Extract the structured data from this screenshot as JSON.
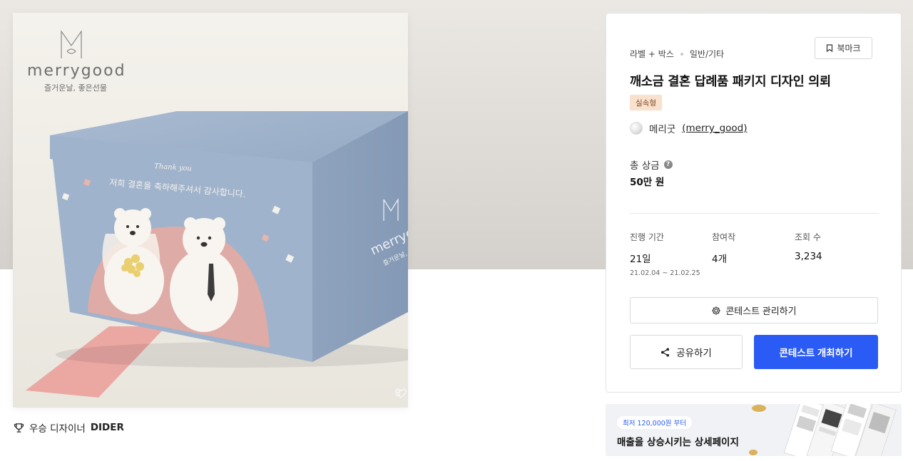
{
  "product": {
    "brand_name": "merrygood",
    "brand_tagline": "즐거운날, 좋은선물",
    "box_script": "Thank you",
    "box_message": "저희 결혼을 축하해주셔서 감사합니다.",
    "side_brand": "merrygood",
    "side_tagline": "즐거운날, 좋은선물",
    "like_count": "3"
  },
  "winner": {
    "prefix": "우승 디자이너",
    "name": "DIDER"
  },
  "contest": {
    "category": "라벨 + 박스",
    "subcategory": "일반/기타",
    "bookmark_label": "북마크",
    "title": "깨소금 결혼 답례품 패키지 디자인 의뢰",
    "badge": "실속형",
    "author_name": "메리굿",
    "author_handle": "(merry_good)",
    "prize_label": "총 상금",
    "prize_value": "50만 원",
    "stats": {
      "period_label": "진행 기간",
      "period_value": "21일",
      "period_range": "21.02.04 ~ 21.02.25",
      "entries_label": "참여작",
      "entries_value": "4개",
      "views_label": "조회 수",
      "views_value": "3,234"
    },
    "manage_label": "콘테스트 관리하기",
    "share_label": "공유하기",
    "host_label": "콘테스트 개최하기"
  },
  "banner": {
    "pill": "최저 120,000원 부터",
    "headline": "매출을 상승시키는 상세페이지"
  },
  "colors": {
    "primary": "#2a5bf5",
    "badge_bg": "#f9e1cd",
    "box_blue": "#a0b3cc",
    "ribbon_pink": "#eba8a3"
  }
}
